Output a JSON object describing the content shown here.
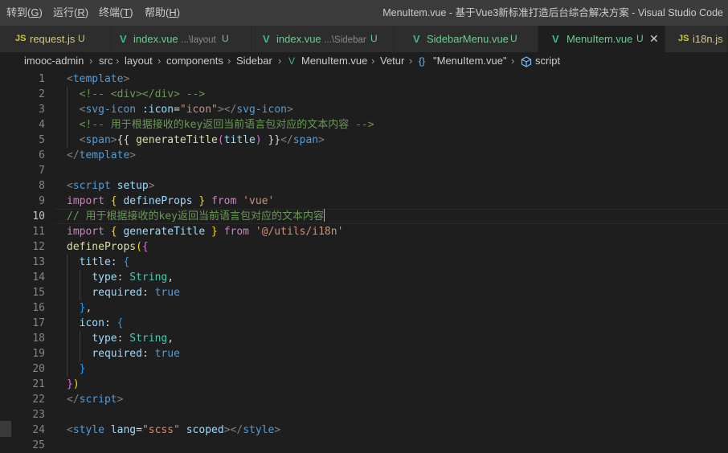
{
  "menu": [
    {
      "label": "转到(",
      "key": "G",
      "tail": ")"
    },
    {
      "label": "运行(",
      "key": "R",
      "tail": ")"
    },
    {
      "label": "终端(",
      "key": "T",
      "tail": ")"
    },
    {
      "label": "帮助(",
      "key": "H",
      "tail": ")"
    }
  ],
  "window_title": "MenuItem.vue - 基于Vue3新标准打造后台综合解决方案 - Visual Studio Code",
  "tabs": [
    {
      "icon": "JS",
      "name": "request.js",
      "path": "",
      "status": "U"
    },
    {
      "icon": "V",
      "name": "index.vue",
      "path": "...\\layout",
      "status": "U"
    },
    {
      "icon": "V",
      "name": "index.vue",
      "path": "...\\Sidebar",
      "status": "U"
    },
    {
      "icon": "V",
      "name": "SidebarMenu.vue",
      "path": "",
      "status": "U"
    },
    {
      "icon": "V",
      "name": "MenuItem.vue",
      "path": "",
      "status": "U",
      "close": "✕"
    },
    {
      "icon": "JS",
      "name": "i18n.js",
      "path": "",
      "status": ""
    }
  ],
  "breadcrumb": {
    "items": [
      "imooc-admin",
      "src",
      "layout",
      "components",
      "Sidebar",
      "MenuItem.vue",
      "Vetur",
      "\"MenuItem.vue\"",
      "script"
    ],
    "sep": "›",
    "braces": "{}"
  },
  "editor": {
    "current_line": 10,
    "lines": [
      {
        "n": "1",
        "tokens": [
          [
            "c-tagp",
            "<"
          ],
          [
            "c-tag",
            "template"
          ],
          [
            "c-tagp",
            ">"
          ]
        ]
      },
      {
        "n": "2",
        "tokens": [
          [
            "c-txt",
            "  "
          ],
          [
            "c-com",
            "<!-- <div></div> -->"
          ]
        ]
      },
      {
        "n": "3",
        "tokens": [
          [
            "c-txt",
            "  "
          ],
          [
            "c-tagp",
            "<"
          ],
          [
            "c-tag",
            "svg-icon"
          ],
          [
            "c-txt",
            " "
          ],
          [
            "c-attr",
            ":icon"
          ],
          [
            "c-txt",
            "="
          ],
          [
            "c-str",
            "\"icon\""
          ],
          [
            "c-tagp",
            "></"
          ],
          [
            "c-tag",
            "svg-icon"
          ],
          [
            "c-tagp",
            ">"
          ]
        ]
      },
      {
        "n": "4",
        "tokens": [
          [
            "c-txt",
            "  "
          ],
          [
            "c-com",
            "<!-- 用于根据接收的key返回当前语言包对应的文本内容 -->"
          ]
        ]
      },
      {
        "n": "5",
        "tokens": [
          [
            "c-txt",
            "  "
          ],
          [
            "c-tagp",
            "<"
          ],
          [
            "c-tag",
            "span"
          ],
          [
            "c-tagp",
            ">"
          ],
          [
            "c-txt",
            "{{ "
          ],
          [
            "c-fn",
            "generateTitle"
          ],
          [
            "c-b2",
            "("
          ],
          [
            "c-var",
            "title"
          ],
          [
            "c-b2",
            ")"
          ],
          [
            "c-txt",
            " }}"
          ],
          [
            "c-tagp",
            "</"
          ],
          [
            "c-tag",
            "span"
          ],
          [
            "c-tagp",
            ">"
          ]
        ]
      },
      {
        "n": "6",
        "tokens": [
          [
            "c-tagp",
            "</"
          ],
          [
            "c-tag",
            "template"
          ],
          [
            "c-tagp",
            ">"
          ]
        ]
      },
      {
        "n": "7",
        "tokens": []
      },
      {
        "n": "8",
        "tokens": [
          [
            "c-tagp",
            "<"
          ],
          [
            "c-tag",
            "script"
          ],
          [
            "c-txt",
            " "
          ],
          [
            "c-attr",
            "setup"
          ],
          [
            "c-tagp",
            ">"
          ]
        ]
      },
      {
        "n": "9",
        "tokens": [
          [
            "c-kw",
            "import"
          ],
          [
            "c-txt",
            " "
          ],
          [
            "c-b1",
            "{"
          ],
          [
            "c-txt",
            " "
          ],
          [
            "c-var",
            "defineProps"
          ],
          [
            "c-txt",
            " "
          ],
          [
            "c-b1",
            "}"
          ],
          [
            "c-txt",
            " "
          ],
          [
            "c-kw",
            "from"
          ],
          [
            "c-txt",
            " "
          ],
          [
            "c-str",
            "'vue'"
          ]
        ]
      },
      {
        "n": "10",
        "tokens": [
          [
            "c-com",
            "// 用于根据接收的key返回当前语言包对应的文本内容"
          ]
        ],
        "cursor": true
      },
      {
        "n": "11",
        "tokens": [
          [
            "c-kw",
            "import"
          ],
          [
            "c-txt",
            " "
          ],
          [
            "c-b1",
            "{"
          ],
          [
            "c-txt",
            " "
          ],
          [
            "c-var",
            "generateTitle"
          ],
          [
            "c-txt",
            " "
          ],
          [
            "c-b1",
            "}"
          ],
          [
            "c-txt",
            " "
          ],
          [
            "c-kw",
            "from"
          ],
          [
            "c-txt",
            " "
          ],
          [
            "c-str",
            "'@/utils/i18n'"
          ]
        ]
      },
      {
        "n": "12",
        "tokens": [
          [
            "c-fn",
            "defineProps"
          ],
          [
            "c-b1",
            "("
          ],
          [
            "c-b2",
            "{"
          ]
        ]
      },
      {
        "n": "13",
        "tokens": [
          [
            "c-txt",
            "  "
          ],
          [
            "c-var",
            "title"
          ],
          [
            "c-txt",
            ": "
          ],
          [
            "c-b3",
            "{"
          ]
        ]
      },
      {
        "n": "14",
        "tokens": [
          [
            "c-txt",
            "    "
          ],
          [
            "c-var",
            "type"
          ],
          [
            "c-txt",
            ": "
          ],
          [
            "c-type",
            "String"
          ],
          [
            "c-txt",
            ","
          ]
        ]
      },
      {
        "n": "15",
        "tokens": [
          [
            "c-txt",
            "    "
          ],
          [
            "c-var",
            "required"
          ],
          [
            "c-txt",
            ": "
          ],
          [
            "c-kw2",
            "true"
          ]
        ]
      },
      {
        "n": "16",
        "tokens": [
          [
            "c-txt",
            "  "
          ],
          [
            "c-b3",
            "}"
          ],
          [
            "c-txt",
            ","
          ]
        ]
      },
      {
        "n": "17",
        "tokens": [
          [
            "c-txt",
            "  "
          ],
          [
            "c-var",
            "icon"
          ],
          [
            "c-txt",
            ": "
          ],
          [
            "c-b3",
            "{"
          ]
        ]
      },
      {
        "n": "18",
        "tokens": [
          [
            "c-txt",
            "    "
          ],
          [
            "c-var",
            "type"
          ],
          [
            "c-txt",
            ": "
          ],
          [
            "c-type",
            "String"
          ],
          [
            "c-txt",
            ","
          ]
        ]
      },
      {
        "n": "19",
        "tokens": [
          [
            "c-txt",
            "    "
          ],
          [
            "c-var",
            "required"
          ],
          [
            "c-txt",
            ": "
          ],
          [
            "c-kw2",
            "true"
          ]
        ]
      },
      {
        "n": "20",
        "tokens": [
          [
            "c-txt",
            "  "
          ],
          [
            "c-b3",
            "}"
          ]
        ]
      },
      {
        "n": "21",
        "tokens": [
          [
            "c-b2",
            "}"
          ],
          [
            "c-b1",
            ")"
          ]
        ]
      },
      {
        "n": "22",
        "tokens": [
          [
            "c-tagp",
            "</"
          ],
          [
            "c-tag",
            "script"
          ],
          [
            "c-tagp",
            ">"
          ]
        ]
      },
      {
        "n": "23",
        "tokens": []
      },
      {
        "n": "24",
        "tokens": [
          [
            "c-tagp",
            "<"
          ],
          [
            "c-tag",
            "style"
          ],
          [
            "c-txt",
            " "
          ],
          [
            "c-attr",
            "lang"
          ],
          [
            "c-txt",
            "="
          ],
          [
            "c-str",
            "\"scss\""
          ],
          [
            "c-txt",
            " "
          ],
          [
            "c-attr",
            "scoped"
          ],
          [
            "c-tagp",
            "></"
          ],
          [
            "c-tag",
            "style"
          ],
          [
            "c-tagp",
            ">"
          ]
        ]
      },
      {
        "n": "25",
        "tokens": []
      }
    ]
  }
}
